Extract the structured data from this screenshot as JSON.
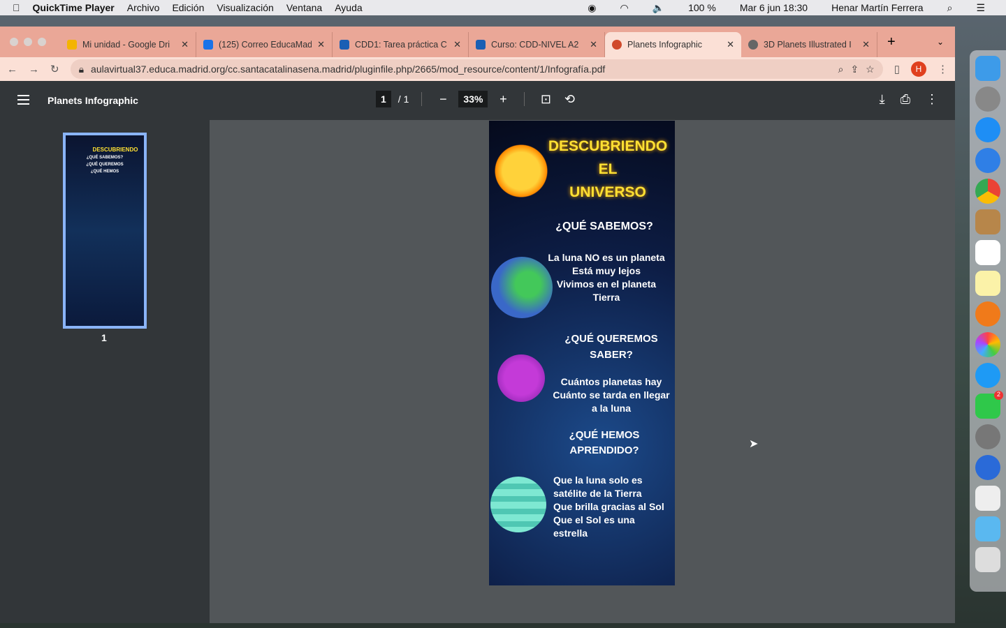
{
  "menubar": {
    "apple": "",
    "app": "QuickTime Player",
    "items": [
      "Archivo",
      "Edición",
      "Visualización",
      "Ventana",
      "Ayuda"
    ],
    "battery": "100 %",
    "datetime": "Mar 6 jun  18:30",
    "user": "Henar Martín Ferrera"
  },
  "tabs": [
    {
      "title": "Mi unidad - Google Dri",
      "color": "#f4b400"
    },
    {
      "title": "(125) Correo EducaMad",
      "color": "#1a73e8"
    },
    {
      "title": "CDD1: Tarea práctica C",
      "color": "#1a5fb4"
    },
    {
      "title": "Curso: CDD-NIVEL A2",
      "color": "#1a5fb4"
    },
    {
      "title": "Planets Infographic",
      "color": "#d04a2c",
      "active": true
    },
    {
      "title": "3D Planets Illustrated I",
      "color": "#666"
    }
  ],
  "address": {
    "url": "aulavirtual37.educa.madrid.org/cc.santacatalinasena.madrid/pluginfile.php/2665/mod_resource/content/1/Infografía.pdf",
    "avatar": "H"
  },
  "pdf": {
    "title": "Planets Infographic",
    "page": "1",
    "total": "/ 1",
    "zoom": "33%",
    "thumb_label": "1"
  },
  "infographic": {
    "title": [
      "DESCUBRIENDO",
      "EL",
      "UNIVERSO"
    ],
    "q1": "¿QUÉ SABEMOS?",
    "a1": [
      "La luna NO es un planeta",
      "Está muy lejos",
      "Vivimos en el planeta",
      "Tierra"
    ],
    "q2": [
      "¿QUÉ QUEREMOS",
      "SABER?"
    ],
    "a2": [
      "Cuántos planetas hay",
      "Cuánto se tarda en llegar",
      "a la luna"
    ],
    "q3": [
      "¿QUÉ HEMOS",
      "APRENDIDO?"
    ],
    "a3": [
      "Que la luna solo es",
      "satélite de la Tierra",
      "Que brilla gracias al Sol",
      "Que el Sol es una",
      "estrella"
    ]
  },
  "dock": {
    "badge": "2"
  }
}
